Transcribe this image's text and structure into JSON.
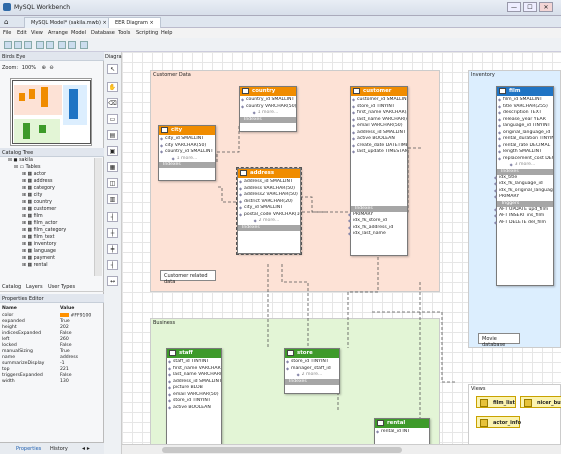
{
  "window": {
    "title": "MySQL Workbench",
    "min": "—",
    "max": "☐",
    "close": "✕"
  },
  "tabs": [
    {
      "label": "MySQL Model* (sakila.mwb)"
    },
    {
      "label": "EER Diagram"
    }
  ],
  "menu": [
    "File",
    "Edit",
    "View",
    "Arrange",
    "Model",
    "Database",
    "Tools",
    "Scripting",
    "Help"
  ],
  "left": {
    "birds_eye": "Birds Eye",
    "zoom_label": "Zoom:",
    "zoom_value": "100%",
    "catalog_tree": "Catalog Tree",
    "tree": [
      "sakila",
      "Tables",
      "actor",
      "address",
      "category",
      "city",
      "country",
      "customer",
      "film",
      "film_actor",
      "film_category",
      "film_text",
      "inventory",
      "language",
      "payment",
      "rental"
    ],
    "tree_tabs": [
      "Catalog",
      "Layers",
      "User Types"
    ],
    "props_title": "Properties Editor",
    "props_head": [
      "Name",
      "Value"
    ],
    "props": [
      [
        "color",
        "#FF9100"
      ],
      [
        "expanded",
        "True"
      ],
      [
        "height",
        "202"
      ],
      [
        "indicesExpanded",
        "False"
      ],
      [
        "left",
        "260"
      ],
      [
        "locked",
        "False"
      ],
      [
        "manualSizing",
        "True"
      ],
      [
        "name",
        "address"
      ],
      [
        "summarizeDisplay",
        "-1"
      ],
      [
        "top",
        "221"
      ],
      [
        "triggersExpanded",
        "False"
      ],
      [
        "width",
        "130"
      ]
    ],
    "bottom_tabs": [
      "Properties",
      "History"
    ]
  },
  "canvas_title": "Diagram",
  "layers": {
    "customer": "Customer Data",
    "business": "Business",
    "inventory": "Inventory",
    "views": "Views"
  },
  "tables": {
    "country": {
      "name": "country",
      "cols": [
        "country_id SMALLINT",
        "country VARCHAR(50)",
        "last_update TIMESTAMP"
      ],
      "more": "1 more...",
      "sub": "Indexes"
    },
    "city": {
      "name": "city",
      "cols": [
        "city_id SMALLINT",
        "city VARCHAR(50)",
        "country_id SMALLINT"
      ],
      "more": "1 more...",
      "sub": "Indexes"
    },
    "address": {
      "name": "address",
      "cols": [
        "address_id SMALLINT",
        "address VARCHAR(50)",
        "address2 VARCHAR(50)",
        "district VARCHAR(20)",
        "city_id SMALLINT",
        "postal_code VARCHAR(10)"
      ],
      "more": "2 more...",
      "sub": "Indexes"
    },
    "customer": {
      "name": "customer",
      "cols": [
        "customer_id SMALLINT",
        "store_id TINYINT",
        "first_name VARCHAR(45)",
        "last_name VARCHAR(45)",
        "email VARCHAR(50)",
        "address_id SMALLINT",
        "active BOOLEAN",
        "create_date DATETIME",
        "last_update TIMESTAMP"
      ],
      "sub": "Indexes",
      "idx": [
        "PRIMARY",
        "idx_fk_store_id",
        "idx_fk_address_id",
        "idx_last_name"
      ]
    },
    "film": {
      "name": "film",
      "cols": [
        "film_id SMALLINT",
        "title VARCHAR(255)",
        "description TEXT",
        "release_year YEAR",
        "language_id TINYINT",
        "original_language_id",
        "rental_duration TINYINT",
        "rental_rate DECIMAL",
        "length SMALLINT",
        "replacement_cost DECIMAL"
      ],
      "more": "3 more...",
      "sub": "Indexes",
      "idx": [
        "idx_title",
        "idx_fk_language_id",
        "idx_fk_original_language",
        "PRIMARY"
      ],
      "trig_sub": "Triggers",
      "trig": [
        "AFT UPDATE upd_film",
        "AFT INSERT ins_film",
        "AFT DELETE del_film"
      ]
    },
    "staff": {
      "name": "staff",
      "cols": [
        "staff_id TINYINT",
        "first_name VARCHAR(45)",
        "last_name VARCHAR(45)",
        "address_id SMALLINT",
        "picture BLOB",
        "email VARCHAR(50)",
        "store_id TINYINT",
        "active BOOLEAN"
      ]
    },
    "store": {
      "name": "store",
      "cols": [
        "store_id TINYINT",
        "manager_staff_id"
      ],
      "more": "2 more...",
      "sub": "Indexes"
    },
    "rental": {
      "name": "rental",
      "cols": [
        "rental_id INT"
      ]
    }
  },
  "notes": {
    "customer": "Customer related data",
    "movie": "Movie database"
  },
  "views": [
    "film_list",
    "nicer_but_slower",
    "actor_info"
  ],
  "colors": {
    "orange": "#f08c00",
    "blue": "#1f74c4",
    "green": "#3e9a2a",
    "customer_layer": "#fde2d6",
    "business_layer": "#e3f5d6",
    "inventory_layer": "#dceefe"
  }
}
